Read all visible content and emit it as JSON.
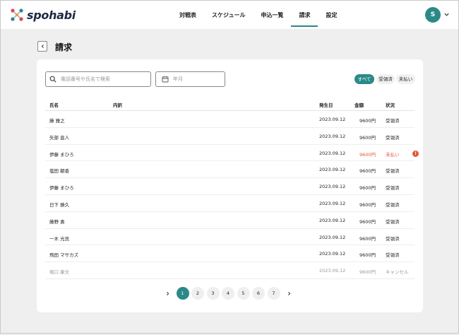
{
  "app": {
    "brand": "spohabi",
    "user_initial": "S"
  },
  "nav": [
    {
      "label": "対戦表",
      "active": false
    },
    {
      "label": "スケジュール",
      "active": false
    },
    {
      "label": "申込一覧",
      "active": false
    },
    {
      "label": "請求",
      "active": true
    },
    {
      "label": "設定",
      "active": false
    }
  ],
  "page": {
    "title": "請求"
  },
  "filters": {
    "search_placeholder": "電話番号や氏名で検索",
    "date_placeholder": "年月",
    "segments": [
      "すべて",
      "受領済",
      "未払い"
    ],
    "selected": "すべて"
  },
  "table": {
    "columns": [
      "氏名",
      "内訳",
      "発生日",
      "金額",
      "状況"
    ],
    "rows": [
      {
        "name": "藤 雅之",
        "date": "2023.09.12",
        "amount": "9600円",
        "status": "受領済"
      },
      {
        "name": "矢部 直人",
        "date": "2023.09.12",
        "amount": "9600円",
        "status": "受領済"
      },
      {
        "name": "伊藤 まひろ",
        "date": "2023.09.12",
        "amount": "9600円",
        "status": "未払い",
        "alert": "!"
      },
      {
        "name": "塩田 朝香",
        "date": "2023.09.12",
        "amount": "9600円",
        "status": "受領済"
      },
      {
        "name": "伊藤 まひろ",
        "date": "2023.09.12",
        "amount": "9600円",
        "status": "受領済"
      },
      {
        "name": "日下 勝久",
        "date": "2023.09.12",
        "amount": "9600円",
        "status": "受領済"
      },
      {
        "name": "藤野 勇",
        "date": "2023.09.12",
        "amount": "9600円",
        "status": "受領済"
      },
      {
        "name": "一木 光良",
        "date": "2023.09.12",
        "amount": "9600円",
        "status": "受領済"
      },
      {
        "name": "飛田 マサカズ",
        "date": "2023.09.12",
        "amount": "9600円",
        "status": "受領済"
      },
      {
        "name": "堀口 康文",
        "date": "2023.09.12",
        "amount": "9600円",
        "status": "キャンセル"
      }
    ]
  },
  "pagination": {
    "pages": [
      "1",
      "2",
      "3",
      "4",
      "5",
      "6",
      "7"
    ],
    "current": "1"
  },
  "colors": {
    "accent": "#2b8a88",
    "alert": "#e2573f"
  },
  "icons": {
    "search": "search-icon",
    "calendar": "calendar-icon",
    "back": "chevron-left-icon",
    "menu": "chevron-down-icon"
  }
}
